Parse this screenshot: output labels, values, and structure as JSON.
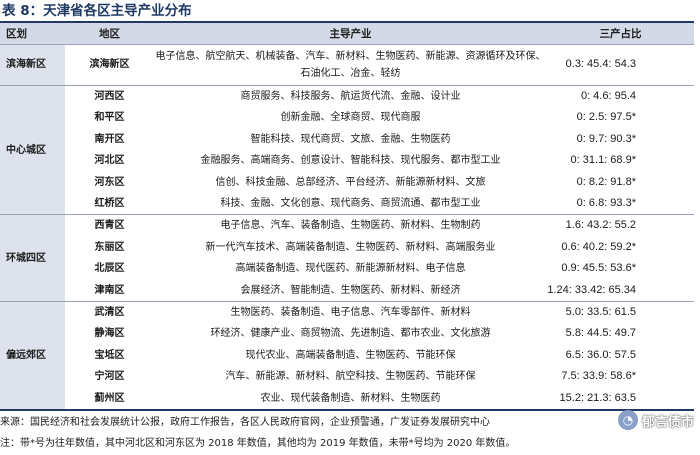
{
  "title": "表 8：天津省各区主导产业分布",
  "headers": {
    "region": "区划",
    "district": "地区",
    "industry": "主导产业",
    "ratio": "三产占比"
  },
  "rows": [
    {
      "region": "滨海新区",
      "district": "滨海新区",
      "industry": "电子信息、航空航天、机械装备、汽车、新材料、生物医药、新能源、资源循环及环保、石油化工、冶金、轻纺",
      "ratio": "0.3: 45.4: 54.3"
    },
    {
      "region": "中心城区",
      "district": "河西区",
      "industry": "商贸服务、科技服务、航运货代流、金融、设计业",
      "ratio": "0: 4.6: 95.4"
    },
    {
      "district": "和平区",
      "industry": "创新金融、全球商贸、现代商服",
      "ratio": "0: 2.5: 97.5*"
    },
    {
      "district": "南开区",
      "industry": "智能科技、现代商贸、文旅、金融、生物医药",
      "ratio": "0: 9.7: 90.3*"
    },
    {
      "district": "河北区",
      "industry": "金融服务、高端商务、创意设计、智能科技、现代服务、都市型工业",
      "ratio": "0: 31.1: 68.9*"
    },
    {
      "district": "河东区",
      "industry": "信创、科技金融、总部经济、平台经济、新能源新材料、文旅",
      "ratio": "0: 8.2: 91.8*"
    },
    {
      "district": "红桥区",
      "industry": "科技、金融、文化创意、现代商务、商贸流通、都市型工业",
      "ratio": "0: 6.8: 93.3*"
    },
    {
      "region": "环城四区",
      "district": "西青区",
      "industry": "电子信息、汽车、装备制造、生物医药、新材料、生物制药",
      "ratio": "1.6: 43.2: 55.2"
    },
    {
      "district": "东丽区",
      "industry": "新一代汽车技术、高端装备制造、生物医药、新材料、高端服务业",
      "ratio": "0.6: 40.2: 59.2*"
    },
    {
      "district": "北辰区",
      "industry": "高端装备制造、现代医药、新能源新材料、电子信息",
      "ratio": "0.9: 45.5: 53.6*"
    },
    {
      "district": "津南区",
      "industry": "会展经济、智能制造、生物医药、新材料、新经济",
      "ratio": "1.24: 33.42: 65.34"
    },
    {
      "region": "偏远郊区",
      "district": "武清区",
      "industry": "生物医药、装备制造、电子信息、汽车零部件、新材料",
      "ratio": "5.0: 33.5: 61.5"
    },
    {
      "district": "静海区",
      "industry": "环经济、健康产业、商贸物流、先进制造、都市农业、文化旅游",
      "ratio": "5.8: 44.5: 49.7"
    },
    {
      "district": "宝坻区",
      "industry": "现代农业、高端装备制造、生物医药、节能环保",
      "ratio": "6.5: 36.0: 57.5"
    },
    {
      "district": "宁河区",
      "industry": "汽车、新能源、新材料、航空科技、生物医药、节能环保",
      "ratio": "7.5: 33.9: 58.6*"
    },
    {
      "district": "蓟州区",
      "industry": "农业、现代装备制造、新材料、生物医药",
      "ratio": "15.2: 21.3: 63.5"
    }
  ],
  "source_line1": "来源：国民经济和社会发展统计公报，政府工作报告，各区人民政府官网，企业预警通，广发证券发展研究中心",
  "source_line2": "注：带*号为往年数值，其中河北区和河东区为 2018 年数值，其他均为 2019 年数值，未带*号均为 2020 年数值。",
  "watermark": "郁言债市"
}
